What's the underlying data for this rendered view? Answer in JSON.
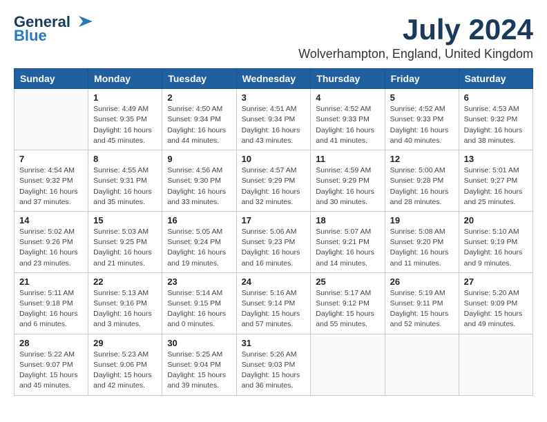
{
  "logo": {
    "line1": "General",
    "line2": "Blue"
  },
  "title": "July 2024",
  "location": "Wolverhampton, England, United Kingdom",
  "headers": [
    "Sunday",
    "Monday",
    "Tuesday",
    "Wednesday",
    "Thursday",
    "Friday",
    "Saturday"
  ],
  "weeks": [
    [
      {
        "day": "",
        "info": ""
      },
      {
        "day": "1",
        "info": "Sunrise: 4:49 AM\nSunset: 9:35 PM\nDaylight: 16 hours\nand 45 minutes."
      },
      {
        "day": "2",
        "info": "Sunrise: 4:50 AM\nSunset: 9:34 PM\nDaylight: 16 hours\nand 44 minutes."
      },
      {
        "day": "3",
        "info": "Sunrise: 4:51 AM\nSunset: 9:34 PM\nDaylight: 16 hours\nand 43 minutes."
      },
      {
        "day": "4",
        "info": "Sunrise: 4:52 AM\nSunset: 9:33 PM\nDaylight: 16 hours\nand 41 minutes."
      },
      {
        "day": "5",
        "info": "Sunrise: 4:52 AM\nSunset: 9:33 PM\nDaylight: 16 hours\nand 40 minutes."
      },
      {
        "day": "6",
        "info": "Sunrise: 4:53 AM\nSunset: 9:32 PM\nDaylight: 16 hours\nand 38 minutes."
      }
    ],
    [
      {
        "day": "7",
        "info": "Sunrise: 4:54 AM\nSunset: 9:32 PM\nDaylight: 16 hours\nand 37 minutes."
      },
      {
        "day": "8",
        "info": "Sunrise: 4:55 AM\nSunset: 9:31 PM\nDaylight: 16 hours\nand 35 minutes."
      },
      {
        "day": "9",
        "info": "Sunrise: 4:56 AM\nSunset: 9:30 PM\nDaylight: 16 hours\nand 33 minutes."
      },
      {
        "day": "10",
        "info": "Sunrise: 4:57 AM\nSunset: 9:29 PM\nDaylight: 16 hours\nand 32 minutes."
      },
      {
        "day": "11",
        "info": "Sunrise: 4:59 AM\nSunset: 9:29 PM\nDaylight: 16 hours\nand 30 minutes."
      },
      {
        "day": "12",
        "info": "Sunrise: 5:00 AM\nSunset: 9:28 PM\nDaylight: 16 hours\nand 28 minutes."
      },
      {
        "day": "13",
        "info": "Sunrise: 5:01 AM\nSunset: 9:27 PM\nDaylight: 16 hours\nand 25 minutes."
      }
    ],
    [
      {
        "day": "14",
        "info": "Sunrise: 5:02 AM\nSunset: 9:26 PM\nDaylight: 16 hours\nand 23 minutes."
      },
      {
        "day": "15",
        "info": "Sunrise: 5:03 AM\nSunset: 9:25 PM\nDaylight: 16 hours\nand 21 minutes."
      },
      {
        "day": "16",
        "info": "Sunrise: 5:05 AM\nSunset: 9:24 PM\nDaylight: 16 hours\nand 19 minutes."
      },
      {
        "day": "17",
        "info": "Sunrise: 5:06 AM\nSunset: 9:23 PM\nDaylight: 16 hours\nand 16 minutes."
      },
      {
        "day": "18",
        "info": "Sunrise: 5:07 AM\nSunset: 9:21 PM\nDaylight: 16 hours\nand 14 minutes."
      },
      {
        "day": "19",
        "info": "Sunrise: 5:08 AM\nSunset: 9:20 PM\nDaylight: 16 hours\nand 11 minutes."
      },
      {
        "day": "20",
        "info": "Sunrise: 5:10 AM\nSunset: 9:19 PM\nDaylight: 16 hours\nand 9 minutes."
      }
    ],
    [
      {
        "day": "21",
        "info": "Sunrise: 5:11 AM\nSunset: 9:18 PM\nDaylight: 16 hours\nand 6 minutes."
      },
      {
        "day": "22",
        "info": "Sunrise: 5:13 AM\nSunset: 9:16 PM\nDaylight: 16 hours\nand 3 minutes."
      },
      {
        "day": "23",
        "info": "Sunrise: 5:14 AM\nSunset: 9:15 PM\nDaylight: 16 hours\nand 0 minutes."
      },
      {
        "day": "24",
        "info": "Sunrise: 5:16 AM\nSunset: 9:14 PM\nDaylight: 15 hours\nand 57 minutes."
      },
      {
        "day": "25",
        "info": "Sunrise: 5:17 AM\nSunset: 9:12 PM\nDaylight: 15 hours\nand 55 minutes."
      },
      {
        "day": "26",
        "info": "Sunrise: 5:19 AM\nSunset: 9:11 PM\nDaylight: 15 hours\nand 52 minutes."
      },
      {
        "day": "27",
        "info": "Sunrise: 5:20 AM\nSunset: 9:09 PM\nDaylight: 15 hours\nand 49 minutes."
      }
    ],
    [
      {
        "day": "28",
        "info": "Sunrise: 5:22 AM\nSunset: 9:07 PM\nDaylight: 15 hours\nand 45 minutes."
      },
      {
        "day": "29",
        "info": "Sunrise: 5:23 AM\nSunset: 9:06 PM\nDaylight: 15 hours\nand 42 minutes."
      },
      {
        "day": "30",
        "info": "Sunrise: 5:25 AM\nSunset: 9:04 PM\nDaylight: 15 hours\nand 39 minutes."
      },
      {
        "day": "31",
        "info": "Sunrise: 5:26 AM\nSunset: 9:03 PM\nDaylight: 15 hours\nand 36 minutes."
      },
      {
        "day": "",
        "info": ""
      },
      {
        "day": "",
        "info": ""
      },
      {
        "day": "",
        "info": ""
      }
    ]
  ]
}
